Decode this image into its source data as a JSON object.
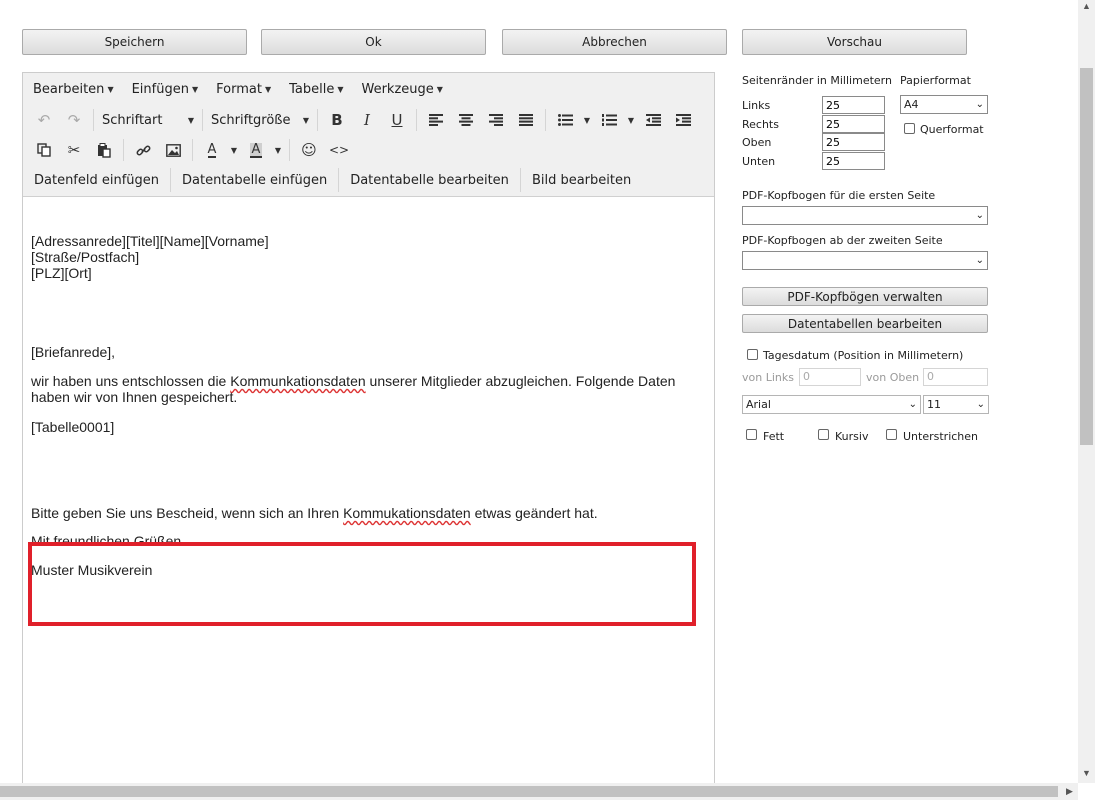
{
  "top_buttons": {
    "save": "Speichern",
    "ok": "Ok",
    "cancel": "Abbrechen",
    "preview": "Vorschau"
  },
  "menubar": [
    "Bearbeiten",
    "Einfügen",
    "Format",
    "Tabelle",
    "Werkzeuge"
  ],
  "toolbar": {
    "font_family": "Schriftart",
    "font_size": "Schriftgröße"
  },
  "custom_buttons": [
    "Datenfeld einfügen",
    "Datentabelle einfügen",
    "Datentabelle bearbeiten",
    "Bild bearbeiten"
  ],
  "document": {
    "address_line1": "[Adressanrede][Titel][Name][Vorname]",
    "address_line2": "[Straße/Postfach]",
    "address_line3": "[PLZ][Ort]",
    "salutation": "[Briefanrede],",
    "body_before": "wir haben uns entschlossen die ",
    "body_misspelled": "Kommunkationsdaten",
    "body_after": " unserer Mitglieder abzugleichen. Folgende Daten haben wir von Ihnen gespeichert.",
    "table_placeholder": "[Tabelle0001]",
    "closing_before": "Bitte geben Sie uns Bescheid, wenn sich an Ihren ",
    "closing_misspelled": "Kommukationsdaten",
    "closing_after": " etwas geändert hat.",
    "regards": "Mit freundlichen Grüßen",
    "signature": "Muster Musikverein"
  },
  "panel": {
    "margins_label": "Seitenränder in Millimetern",
    "paper_label": "Papierformat",
    "left_label": "Links",
    "right_label": "Rechts",
    "top_label": "Oben",
    "bottom_label": "Unten",
    "left_value": "25",
    "right_value": "25",
    "top_value": "25",
    "bottom_value": "25",
    "paper_value": "A4",
    "landscape_label": "Querformat",
    "letterhead_first_label": "PDF-Kopfbogen für die ersten Seite",
    "letterhead_second_label": "PDF-Kopfbogen ab der zweiten Seite",
    "manage_letterheads": "PDF-Kopfbögen verwalten",
    "edit_datatables": "Datentabellen bearbeiten",
    "date_label": "Tagesdatum (Position in Millimetern)",
    "from_left_label": "von Links",
    "from_top_label": "von Oben",
    "from_left_value": "0",
    "from_top_value": "0",
    "font_value": "Arial",
    "size_value": "11",
    "bold_label": "Fett",
    "italic_label": "Kursiv",
    "underline_label": "Unterstrichen"
  }
}
